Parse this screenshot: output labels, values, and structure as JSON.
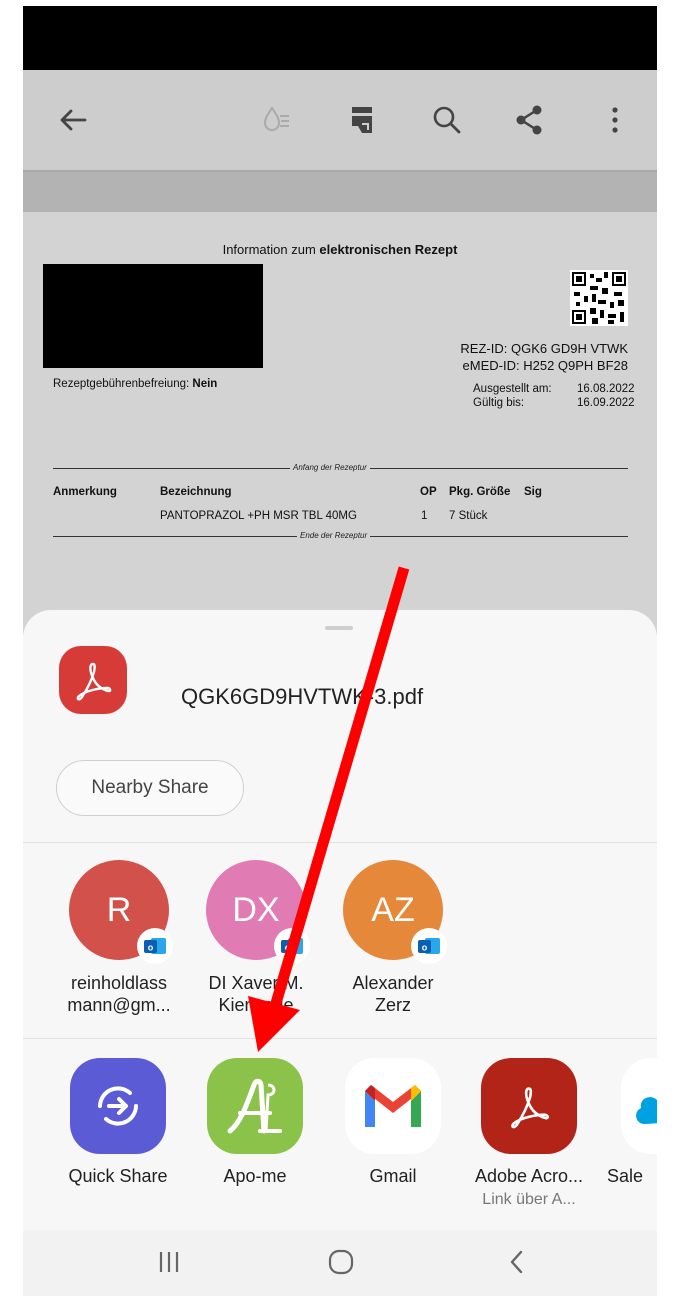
{
  "toolbar": {
    "back_icon": "arrow-left-icon",
    "icons": [
      "reflow-icon",
      "reader-mode-icon",
      "search-icon",
      "share-icon",
      "more-vert-icon"
    ]
  },
  "document": {
    "title_prefix": "Information zum ",
    "title_bold": "elektronischen Rezept",
    "rez_id": "REZ-ID: QGK6 GD9H VTWK",
    "emed_id": "eMED-ID: H252 Q9PH BF28",
    "gebuehr_label": "Rezeptgebührenbefreiung: ",
    "gebuehr_value": "Nein",
    "ausgestellt_label": "Ausgestellt am:",
    "ausgestellt_value": "16.08.2022",
    "gueltig_label": "Gültig bis:",
    "gueltig_value": "16.09.2022",
    "anfang_label": "Anfang der Rezeptur",
    "ende_label": "Ende der Rezeptur",
    "columns": {
      "anmerkung": "Anmerkung",
      "bezeichnung": "Bezeichnung",
      "op": "OP",
      "pkg": "Pkg. Größe",
      "sig": "Sig"
    },
    "row": {
      "bezeichnung": "PANTOPRAZOL +PH MSR TBL 40MG",
      "op": "1",
      "pkg": "7 Stück"
    }
  },
  "share_sheet": {
    "file_name": "QGK6GD9HVTWK-3.pdf",
    "nearby_share": "Nearby Share",
    "contacts": [
      {
        "initials": "R",
        "line1": "reinholdlass",
        "line2": "mann@gm...",
        "color": "#d2514a"
      },
      {
        "initials": "DX",
        "line1": "DI Xaver M.",
        "line2": "Kienzerle",
        "color": "#e07bb4"
      },
      {
        "initials": "AZ",
        "line1": "Alexander",
        "line2": "Zerz",
        "color": "#e5883a"
      }
    ],
    "apps": [
      {
        "label": "Quick Share",
        "sub": ""
      },
      {
        "label": "Apo-me",
        "sub": ""
      },
      {
        "label": "Gmail",
        "sub": ""
      },
      {
        "label": "Adobe Acro...",
        "sub": "Link über A..."
      },
      {
        "label": "Sale",
        "sub": ""
      }
    ]
  },
  "navbar": {
    "icons": [
      "recent-apps-icon",
      "home-icon",
      "back-icon"
    ]
  },
  "colors": {
    "annotation_arrow": "#ff0000",
    "pdf_red": "#d63b38",
    "apo_green": "#8bc34a",
    "quick_share": "#5b5bd6"
  }
}
